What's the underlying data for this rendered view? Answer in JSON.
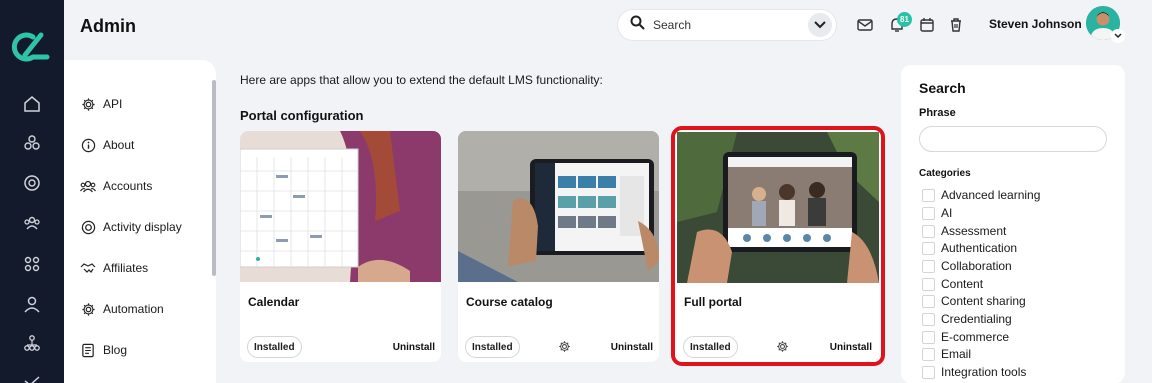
{
  "header": {
    "title": "Admin",
    "search_placeholder": "Search",
    "notification_count": "81",
    "user_name": "Steven Johnson"
  },
  "sidebar_menu": {
    "items": [
      {
        "label": "API",
        "icon": "gear-icon"
      },
      {
        "label": "About",
        "icon": "info-icon"
      },
      {
        "label": "Accounts",
        "icon": "users-icon"
      },
      {
        "label": "Activity display",
        "icon": "target-icon"
      },
      {
        "label": "Affiliates",
        "icon": "handshake-icon"
      },
      {
        "label": "Automation",
        "icon": "gear-icon"
      },
      {
        "label": "Blog",
        "icon": "document-icon"
      }
    ]
  },
  "rail": {
    "items": [
      "home-icon",
      "modules-icon",
      "compass-icon",
      "people-icon",
      "grid-icon",
      "user-icon",
      "hierarchy-icon",
      "chart-icon"
    ]
  },
  "main": {
    "intro": "Here are apps that allow you to extend the default LMS functionality:",
    "section_title": "Portal configuration",
    "cards": [
      {
        "name": "Calendar",
        "status": "Installed",
        "action": "Uninstall",
        "has_settings": false
      },
      {
        "name": "Course catalog",
        "status": "Installed",
        "action": "Uninstall",
        "has_settings": true
      },
      {
        "name": "Full portal",
        "status": "Installed",
        "action": "Uninstall",
        "has_settings": true,
        "selected": true
      }
    ]
  },
  "filter_panel": {
    "title": "Search",
    "phrase_label": "Phrase",
    "phrase_value": "",
    "categories_label": "Categories",
    "categories": [
      "Advanced learning",
      "AI",
      "Assessment",
      "Authentication",
      "Collaboration",
      "Content",
      "Content sharing",
      "Credentialing",
      "E-commerce",
      "Email",
      "Integration tools"
    ]
  },
  "colors": {
    "rail": "#131a2b",
    "accent": "#29c2a6",
    "selection": "#e0121b"
  }
}
